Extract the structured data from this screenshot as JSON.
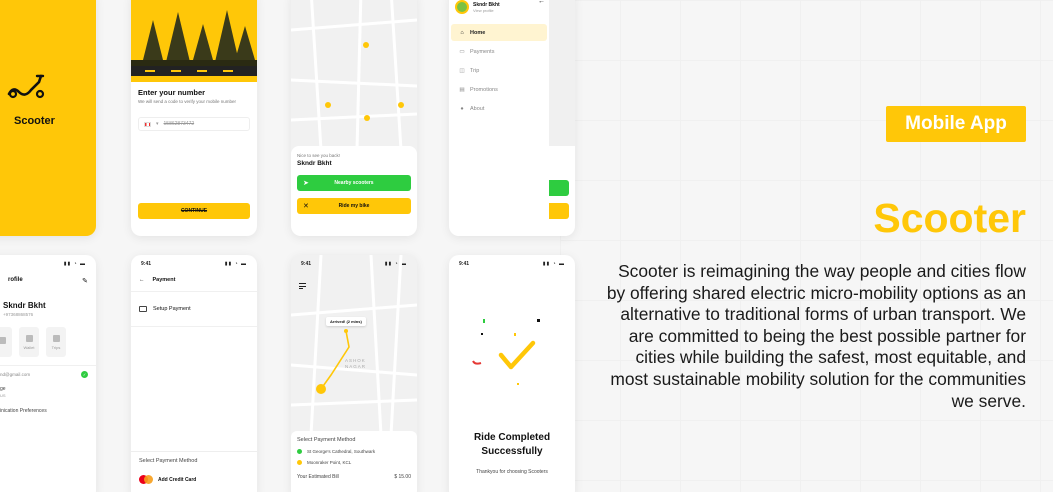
{
  "colors": {
    "accent": "#ffc708",
    "green": "#2ecc40",
    "bg": "#f6f6f6"
  },
  "badge": "Mobile App",
  "title": "Scooter",
  "description": "Scooter is reimagining the way people and cities flow by offering shared electric micro-mobility options as an alternative to traditional forms of urban transport. We are committed to being the best possible partner for cities while building the safest, most equitable, and most sustainable mobility solution for the communities we serve.",
  "splash": {
    "app_name": "Scooter",
    "icon": "scooter-icon"
  },
  "verify": {
    "heading": "Enter your number",
    "subtext": "We will send a code to verify your mobile number",
    "phone_value": "15862873472",
    "continue_label": "CONTINUE"
  },
  "home": {
    "greeting": "Nice to see you back!",
    "user_name": "Skndr Bkht",
    "nearby_label": "Nearby scooters",
    "ride_label": "Ride my bike"
  },
  "menu": {
    "user_name": "Skndr Bkht",
    "view_profile": "View profile",
    "items": [
      {
        "label": "Home",
        "icon": "home-icon",
        "active": true
      },
      {
        "label": "Payments",
        "icon": "card-icon",
        "active": false
      },
      {
        "label": "Trip",
        "icon": "trip-icon",
        "active": false
      },
      {
        "label": "Promotions",
        "icon": "promo-icon",
        "active": false
      },
      {
        "label": "About",
        "icon": "info-icon",
        "active": false
      }
    ]
  },
  "profile": {
    "title": "rofile",
    "user_name": "Skndr Bkht",
    "phone": "+97368868576",
    "tiles": [
      "",
      "Wallet",
      "Trips"
    ],
    "email": "nd@gmail.com",
    "row2_line1": "ge",
    "row2_line2": "US",
    "row3": "inication Preferences"
  },
  "payment": {
    "title": "Payment",
    "setup_label": "Setup Payment",
    "select_label": "Select Payment Method",
    "add_card_label": "Add Credit Card"
  },
  "route": {
    "time": "9:41",
    "arrived_label": "Arrived! (2 mins)",
    "area_label": "ASHOK NAGAR",
    "select_label": "Select Payment Method",
    "stops": [
      "St George's Cathedral, Southwark",
      "Moonraker Point, KCL"
    ],
    "bill_label": "Your Estimated Bill",
    "bill_value": "$ 15.00"
  },
  "done": {
    "time": "9:41",
    "title_line1": "Ride Completed",
    "title_line2": "Successfully",
    "subtitle": "Thankyou for choosing Scooters"
  },
  "status_time": "9:41"
}
